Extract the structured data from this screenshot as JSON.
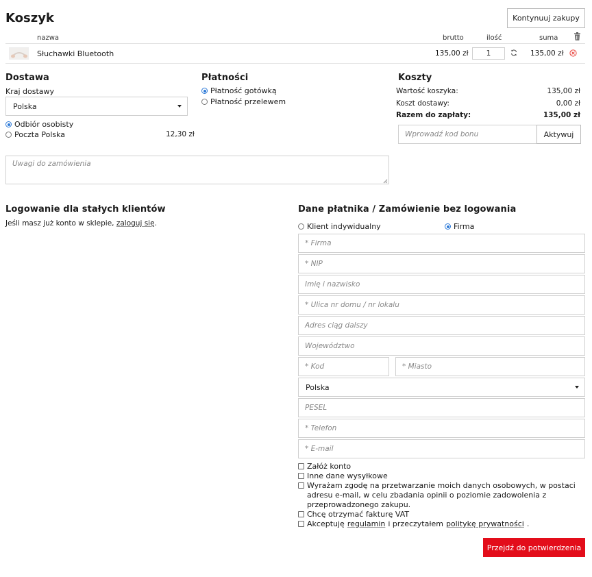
{
  "page": {
    "title": "Koszyk",
    "continue_label": "Kontynuuj zakupy"
  },
  "cart": {
    "headers": {
      "name": "nazwa",
      "gross": "brutto",
      "qty": "ilość",
      "sum": "suma"
    },
    "item": {
      "name": "Słuchawki Bluetooth",
      "gross": "135,00 zł",
      "qty": "1",
      "sum": "135,00 zł"
    }
  },
  "delivery": {
    "title": "Dostawa",
    "country_label": "Kraj dostawy",
    "country_value": "Polska",
    "options": [
      {
        "label": "Odbiór osobisty",
        "price": "",
        "selected": true
      },
      {
        "label": "Poczta Polska",
        "price": "12,30 zł",
        "selected": false
      }
    ]
  },
  "payment": {
    "title": "Płatności",
    "options": [
      {
        "label": "Płatność gotówką",
        "selected": true
      },
      {
        "label": "Płatność przelewem",
        "selected": false
      }
    ]
  },
  "costs": {
    "title": "Koszty",
    "cart_value_label": "Wartość koszyka:",
    "cart_value": "135,00 zł",
    "shipping_label": "Koszt dostawy:",
    "shipping": "0,00 zł",
    "total_label": "Razem do zapłaty:",
    "total": "135,00 zł",
    "voucher_placeholder": "Wprowadź kod bonu",
    "activate_label": "Aktywuj"
  },
  "notes": {
    "placeholder": "Uwagi do zamówienia"
  },
  "login": {
    "title": "Logowanie dla stałych klientów",
    "text_before": "Jeśli masz już konto w sklepie,",
    "link": "zaloguj się",
    "text_after": "."
  },
  "payer": {
    "title": "Dane płatnika / Zamówienie bez logowania",
    "type_individual": "Klient indywidualny",
    "type_company": "Firma",
    "fields": {
      "company": "* Firma",
      "nip": "* NIP",
      "name": "Imię i nazwisko",
      "street": "* Ulica nr domu / nr lokalu",
      "address2": "Adres ciąg dalszy",
      "province": "Województwo",
      "zip": "* Kod",
      "city": "* Miasto",
      "country": "Polska",
      "pesel": "PESEL",
      "phone": "* Telefon",
      "email": "* E-mail"
    },
    "checkboxes": {
      "create_account": "Załóż konto",
      "other_shipping": "Inne dane wysyłkowe",
      "consent": "Wyrażam zgodę na przetwarzanie moich danych osobowych, w postaci adresu e-mail, w celu zbadania opinii o poziomie zadowolenia z przeprowadzonego zakupu.",
      "vat_invoice": "Chcę otrzymać fakturę VAT",
      "accept_before": "Akceptuję",
      "accept_terms": "regulamin",
      "accept_middle": "i przeczytałem",
      "accept_privacy": "politykę prywatności",
      "accept_after": "."
    },
    "submit_label": "Przejdź do potwierdzenia"
  }
}
